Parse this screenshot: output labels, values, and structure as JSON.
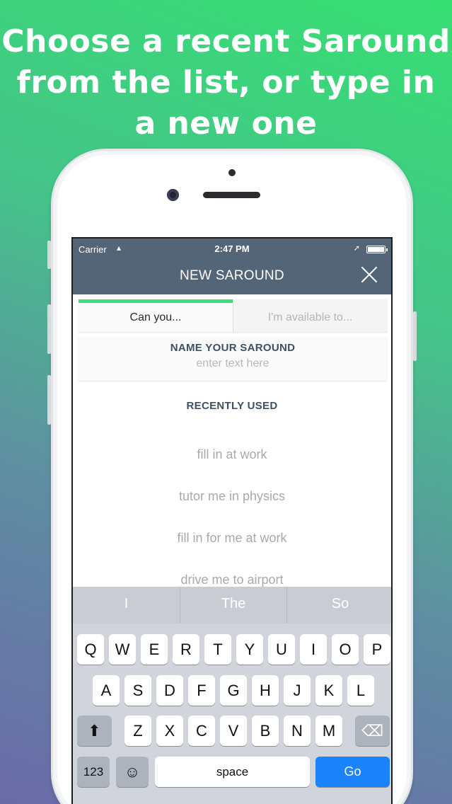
{
  "headline": [
    "Choose a recent Saround",
    "from the list, or type in",
    "a new one"
  ],
  "status": {
    "carrier": "Carrier",
    "wifi_icon": "▴",
    "time": "2:47 PM",
    "location_icon": "➚"
  },
  "nav": {
    "title": "NEW SAROUND"
  },
  "tabs": [
    {
      "label": "Can you...",
      "active": true
    },
    {
      "label": "I'm available to...",
      "active": false
    }
  ],
  "name_section": {
    "title": "NAME YOUR SAROUND",
    "placeholder": "enter text here"
  },
  "recent": {
    "title": "RECENTLY USED",
    "items": [
      "fill in at work",
      "tutor me in physics",
      "fill in for me at work",
      "drive me to airport"
    ]
  },
  "suggestions": [
    "I",
    "The",
    "So"
  ],
  "keyboard": {
    "row1": [
      "Q",
      "W",
      "E",
      "R",
      "T",
      "Y",
      "U",
      "I",
      "O",
      "P"
    ],
    "row2": [
      "A",
      "S",
      "D",
      "F",
      "G",
      "H",
      "J",
      "K",
      "L"
    ],
    "row3": [
      "Z",
      "X",
      "C",
      "V",
      "B",
      "N",
      "M"
    ],
    "shift_icon": "⬆",
    "backspace_icon": "⌫",
    "numbers_label": "123",
    "emoji_icon": "☺",
    "space_label": "space",
    "go_label": "Go"
  },
  "colors": {
    "accent": "#3be07a",
    "navbar": "#546577",
    "go_key": "#1a82fb"
  }
}
